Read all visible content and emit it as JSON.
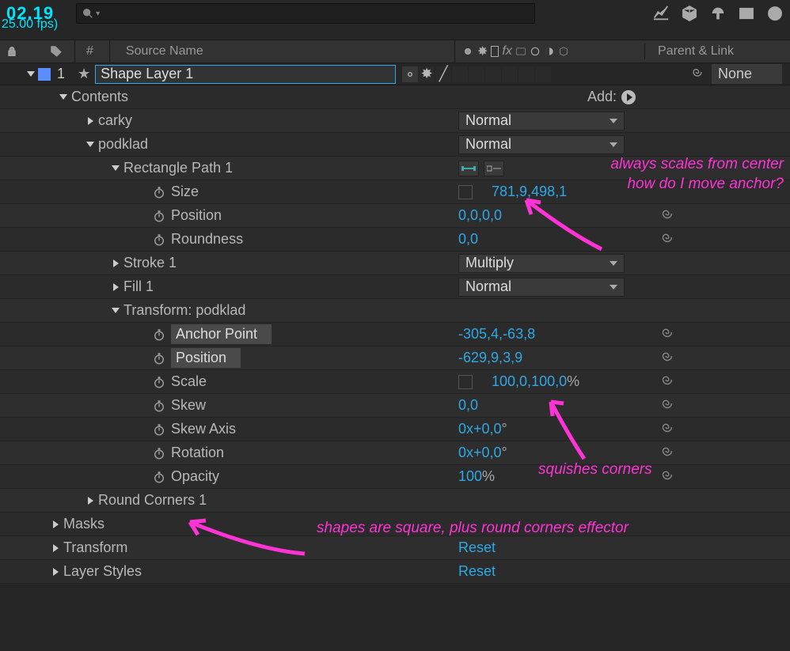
{
  "timecode": "02.19",
  "fps": "25.00 fps)",
  "header": {
    "hash": "#",
    "source": "Source Name",
    "parent": "Parent & Link"
  },
  "layer": {
    "num": "1",
    "name": "Shape Layer 1",
    "parent": "None"
  },
  "contents": {
    "label": "Contents",
    "add": "Add:"
  },
  "groups": {
    "carky": "carky",
    "podklad": "podklad",
    "rect": "Rectangle Path 1",
    "stroke": "Stroke 1",
    "fill": "Fill 1",
    "transform": "Transform: podklad",
    "round": "Round Corners 1",
    "masks": "Masks",
    "transform2": "Transform",
    "styles": "Layer Styles"
  },
  "blend": {
    "normal1": "Normal",
    "normal2": "Normal",
    "multiply": "Multiply",
    "normal3": "Normal"
  },
  "props": {
    "size": {
      "label": "Size",
      "v1": "781,9",
      "v2": "498,1"
    },
    "pos": {
      "label": "Position",
      "v1": "0,0",
      "v2": "0,0"
    },
    "round": {
      "label": "Roundness",
      "v": "0,0"
    },
    "anchor": {
      "label": "Anchor Point",
      "v1": "-305,4",
      "v2": "-63,8"
    },
    "pos2": {
      "label": "Position",
      "v1": "-629,9",
      "v2": "3,9"
    },
    "scale": {
      "label": "Scale",
      "v1": "100,0",
      "v2": "100,0",
      "unit": "%"
    },
    "skew": {
      "label": "Skew",
      "v": "0,0"
    },
    "skewax": {
      "label": "Skew Axis",
      "v": "0x+0,0",
      "unit": "°"
    },
    "rot": {
      "label": "Rotation",
      "v": "0x+0,0",
      "unit": "°"
    },
    "opa": {
      "label": "Opacity",
      "v": "100",
      "unit": "%"
    }
  },
  "reset": "Reset",
  "annot": {
    "a1": "always scales from center",
    "a2": "how do I move anchor?",
    "a3": "squishes corners",
    "a4": "shapes are square, plus round corners effector"
  }
}
